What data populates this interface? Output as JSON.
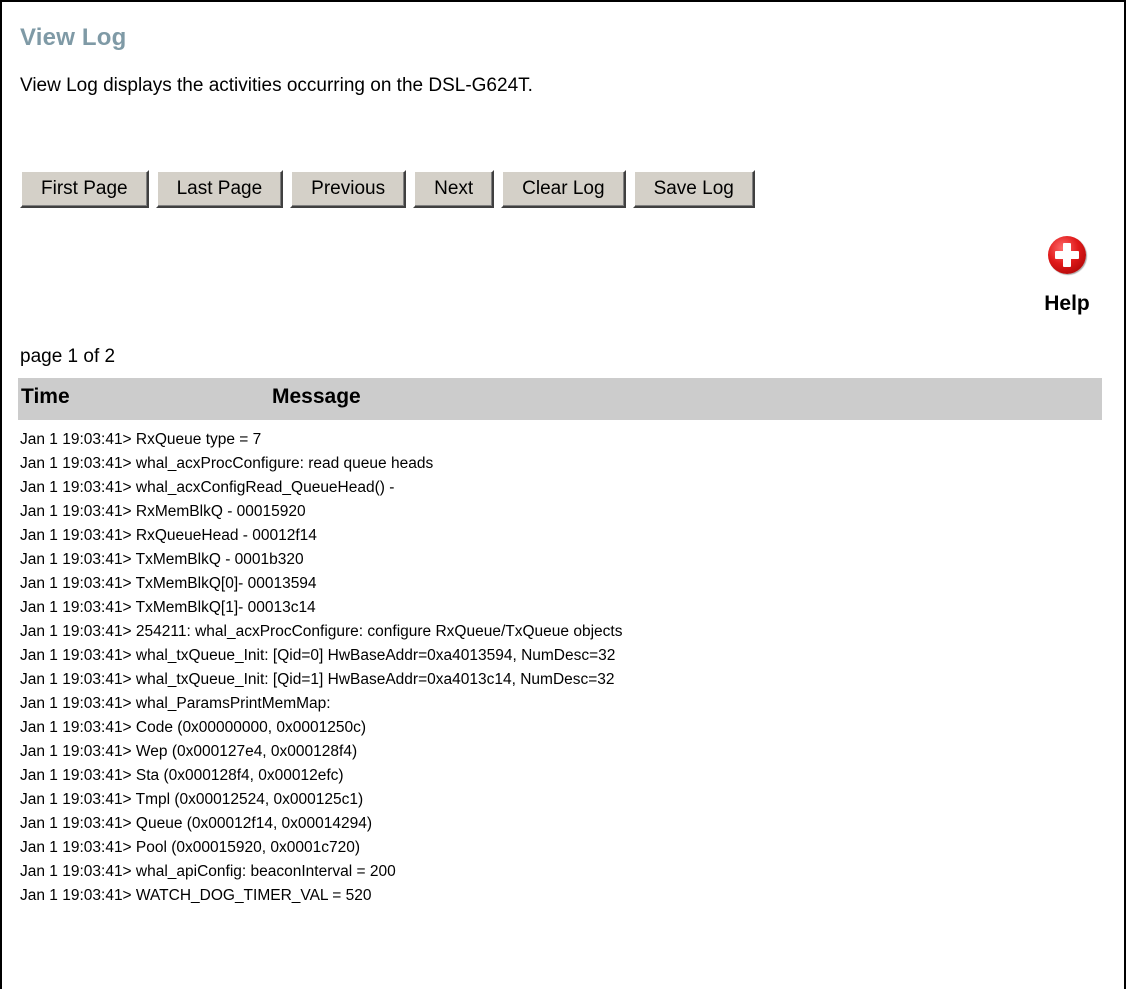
{
  "page": {
    "title": "View Log",
    "description": "View Log displays the activities occurring on the DSL-G624T."
  },
  "buttons": {
    "first_page": "First Page",
    "last_page": "Last Page",
    "previous": "Previous",
    "next": "Next",
    "clear_log": "Clear Log",
    "save_log": "Save Log"
  },
  "help": {
    "label": "Help",
    "icon": "plus-circle-icon",
    "color": "#e01a1a"
  },
  "pagination": {
    "text": "page 1 of 2",
    "current": 1,
    "total": 2
  },
  "table": {
    "header_time": "Time",
    "header_message": "Message",
    "header_color": "#cccccc",
    "rows": [
      "Jan 1 19:03:41> RxQueue type = 7",
      "Jan 1 19:03:41> whal_acxProcConfigure: read queue heads",
      "Jan 1 19:03:41> whal_acxConfigRead_QueueHead() -",
      "Jan 1 19:03:41> RxMemBlkQ - 00015920",
      "Jan 1 19:03:41> RxQueueHead - 00012f14",
      "Jan 1 19:03:41> TxMemBlkQ - 0001b320",
      "Jan 1 19:03:41> TxMemBlkQ[0]- 00013594",
      "Jan 1 19:03:41> TxMemBlkQ[1]- 00013c14",
      "Jan 1 19:03:41> 254211: whal_acxProcConfigure: configure RxQueue/TxQueue objects",
      "Jan 1 19:03:41> whal_txQueue_Init: [Qid=0] HwBaseAddr=0xa4013594, NumDesc=32",
      "Jan 1 19:03:41> whal_txQueue_Init: [Qid=1] HwBaseAddr=0xa4013c14, NumDesc=32",
      "Jan 1 19:03:41> whal_ParamsPrintMemMap:",
      "Jan 1 19:03:41> Code (0x00000000, 0x0001250c)",
      "Jan 1 19:03:41> Wep (0x000127e4, 0x000128f4)",
      "Jan 1 19:03:41> Sta (0x000128f4, 0x00012efc)",
      "Jan 1 19:03:41> Tmpl (0x00012524, 0x000125c1)",
      "Jan 1 19:03:41> Queue (0x00012f14, 0x00014294)",
      "Jan 1 19:03:41> Pool (0x00015920, 0x0001c720)",
      "Jan 1 19:03:41> whal_apiConfig: beaconInterval = 200",
      "Jan 1 19:03:41> WATCH_DOG_TIMER_VAL = 520"
    ]
  }
}
